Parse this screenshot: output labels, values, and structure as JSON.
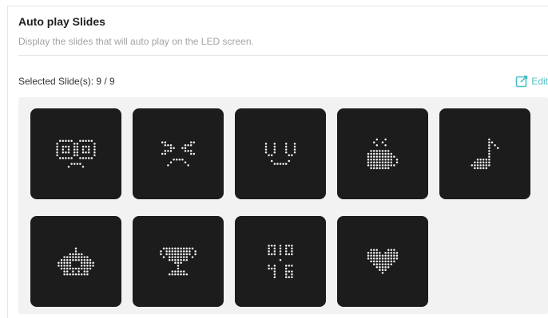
{
  "section": {
    "title": "Auto play Slides",
    "description": "Display the slides that will auto play on the LED screen."
  },
  "selection": {
    "label": "Selected Slide(s): 9 / 9",
    "edit_label": "Edit"
  },
  "colors": {
    "accent": "#4dbfc4",
    "slide_background": "#1c1c1c",
    "panel_background": "#f2f2f2"
  },
  "slides": [
    {
      "icon": "eyes-face-icon"
    },
    {
      "icon": "squint-face-icon"
    },
    {
      "icon": "smile-face-icon"
    },
    {
      "icon": "coffee-cup-icon"
    },
    {
      "icon": "music-note-icon"
    },
    {
      "icon": "robot-icon"
    },
    {
      "icon": "trophy-icon"
    },
    {
      "icon": "clock-digits-icon"
    },
    {
      "icon": "heart-icon"
    }
  ]
}
